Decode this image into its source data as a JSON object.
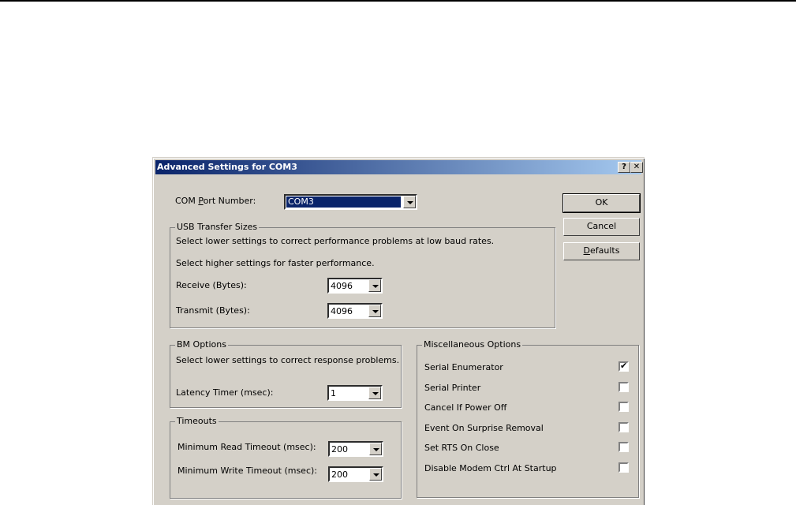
{
  "dialog": {
    "title": "Advanced Settings for COM3",
    "help_button": "?",
    "close_button": "✕"
  },
  "com_port": {
    "label_pre": "COM ",
    "label_u": "P",
    "label_post": "ort Number:",
    "value": "COM3"
  },
  "buttons": {
    "ok": "OK",
    "cancel": "Cancel",
    "defaults_u": "D",
    "defaults_rest": "efaults"
  },
  "usb": {
    "title": "USB Transfer Sizes",
    "desc1": "Select lower settings to correct performance problems at low baud rates.",
    "desc2": "Select higher settings for faster performance.",
    "receive_label": "Receive (Bytes):",
    "receive_value": "4096",
    "transmit_label": "Transmit (Bytes):",
    "transmit_value": "4096"
  },
  "bm": {
    "title": "BM Options",
    "desc": "Select lower settings to correct response problems.",
    "latency_label": "Latency Timer (msec):",
    "latency_value": "1"
  },
  "timeouts": {
    "title": "Timeouts",
    "read_label": "Minimum Read Timeout (msec):",
    "read_value": "200",
    "write_label": "Minimum Write Timeout (msec):",
    "write_value": "200"
  },
  "misc": {
    "title": "Miscellaneous Options",
    "options": [
      {
        "label": "Serial Enumerator",
        "checked": true
      },
      {
        "label": "Serial Printer",
        "checked": false
      },
      {
        "label": "Cancel If Power Off",
        "checked": false
      },
      {
        "label": "Event On Surprise Removal",
        "checked": false
      },
      {
        "label": "Set RTS On Close",
        "checked": false
      },
      {
        "label": "Disable Modem Ctrl At Startup",
        "checked": false
      }
    ],
    "check_glyph": "✔"
  },
  "colors": {
    "face": "#d4d0c8",
    "title_start": "#0a246a",
    "title_end": "#a6caf0"
  }
}
